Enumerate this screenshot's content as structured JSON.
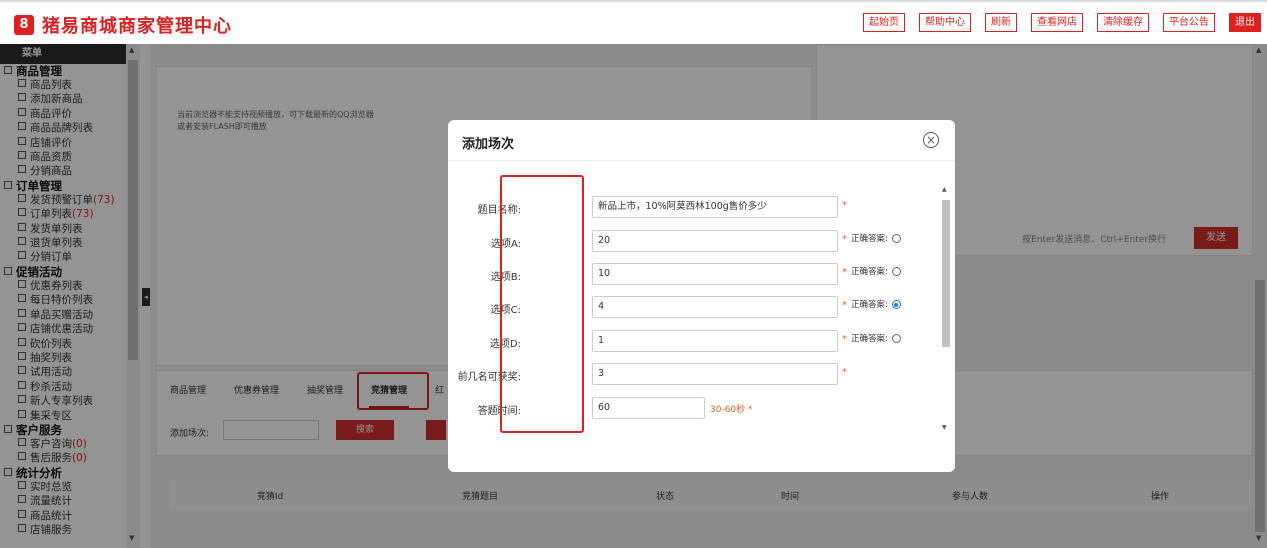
{
  "header": {
    "logo_glyph": "8",
    "title": "猪易商城商家管理中心",
    "buttons": [
      "起始页",
      "帮助中心",
      "刷新",
      "查看网店",
      "清除缓存",
      "平台公告"
    ],
    "exit": "退出"
  },
  "sidebar": {
    "menu_title": "菜单",
    "groups": [
      {
        "title": "商品管理",
        "items": [
          {
            "label": "商品列表"
          },
          {
            "label": "添加新商品"
          },
          {
            "label": "商品评价"
          },
          {
            "label": "商品品牌列表"
          },
          {
            "label": "店铺评价"
          },
          {
            "label": "商品资质"
          },
          {
            "label": "分销商品"
          }
        ]
      },
      {
        "title": "订单管理",
        "items": [
          {
            "label": "发货预警订单",
            "count": "(73)"
          },
          {
            "label": "订单列表",
            "count": "(73)"
          },
          {
            "label": "发货单列表"
          },
          {
            "label": "退货单列表"
          },
          {
            "label": "分销订单"
          }
        ]
      },
      {
        "title": "促销活动",
        "items": [
          {
            "label": "优惠券列表"
          },
          {
            "label": "每日特价列表"
          },
          {
            "label": "单品买赠活动"
          },
          {
            "label": "店铺优惠活动"
          },
          {
            "label": "砍价列表"
          },
          {
            "label": "抽奖列表"
          },
          {
            "label": "试用活动"
          },
          {
            "label": "秒杀活动"
          },
          {
            "label": "新人专享列表"
          },
          {
            "label": "集采专区"
          }
        ]
      },
      {
        "title": "客户服务",
        "items": [
          {
            "label": "客户咨询",
            "count": "(0)"
          },
          {
            "label": "售后服务",
            "count": "(0)"
          }
        ]
      },
      {
        "title": "统计分析",
        "items": [
          {
            "label": "实时总览"
          },
          {
            "label": "流量统计"
          },
          {
            "label": "商品统计"
          },
          {
            "label": "店铺服务"
          }
        ]
      }
    ]
  },
  "main": {
    "video_note": "当前浏览器不能支持视频播放，可下载最新的QQ浏览器或者安装FLASH即可播放",
    "chat_hint": "按Enter发送消息、Ctrl+Enter换行",
    "send": "发送",
    "tabs": [
      "商品管理",
      "优惠券管理",
      "抽奖管理",
      "竞猜管理",
      "红"
    ],
    "search_label": "添加场次:",
    "search_btn": "搜索",
    "table_headers": [
      "竞猜Id",
      "竞猜题目",
      "状态",
      "时间",
      "参与人数",
      "操作"
    ]
  },
  "modal": {
    "title": "添加场次",
    "fields": {
      "topic": {
        "label": "题目名称:",
        "value": "新品上市，10%阿莫西林100g售价多少"
      },
      "a": {
        "label": "选项A:",
        "value": "20"
      },
      "b": {
        "label": "选项B:",
        "value": "10"
      },
      "c": {
        "label": "选项C:",
        "value": "4"
      },
      "d": {
        "label": "选项D:",
        "value": "1"
      },
      "winners": {
        "label": "前几名可获奖:",
        "value": "3"
      },
      "duration": {
        "label": "答题时间:",
        "value": "60",
        "hint": "30-60秒 *"
      }
    },
    "correct_label": "正确答案:",
    "required_mark": "*",
    "correct_answer": "C"
  }
}
